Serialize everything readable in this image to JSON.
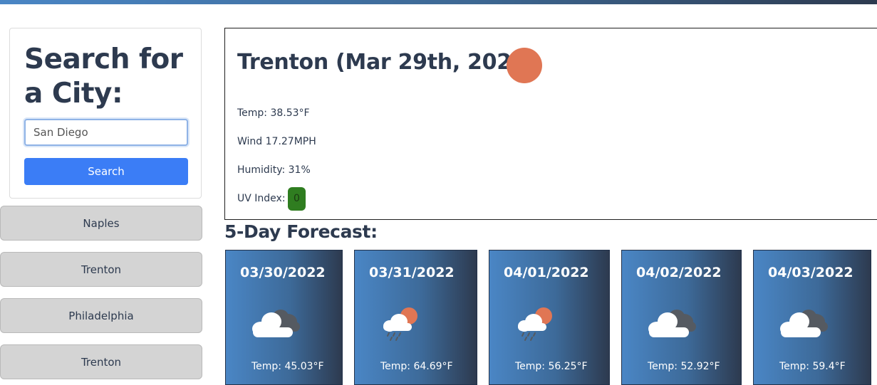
{
  "search": {
    "title": "Search for a City:",
    "input_value": "San Diego",
    "button_label": "Search"
  },
  "history": [
    "Naples",
    "Trenton",
    "Philadelphia",
    "Trenton"
  ],
  "current": {
    "title": "Trenton (Mar 29th, 2022)",
    "icon": "sun-icon",
    "temp": "Temp: 38.53°F",
    "wind": "Wind 17.27MPH",
    "humidity": "Humidity: 31%",
    "uv_label": "UV Index:",
    "uv_value": "0",
    "uv_color": "#2f7d20"
  },
  "forecast_heading": "5-Day Forecast:",
  "forecast": [
    {
      "date": "03/30/2022",
      "icon": "cloudy-icon",
      "temp": "Temp: 45.03°F"
    },
    {
      "date": "03/31/2022",
      "icon": "rain-sun-icon",
      "temp": "Temp: 64.69°F"
    },
    {
      "date": "04/01/2022",
      "icon": "rain-sun-icon",
      "temp": "Temp: 56.25°F"
    },
    {
      "date": "04/02/2022",
      "icon": "cloudy-icon",
      "temp": "Temp: 52.92°F"
    },
    {
      "date": "04/03/2022",
      "icon": "cloudy-icon",
      "temp": "Temp: 59.4°F"
    }
  ],
  "colors": {
    "accent_blue": "#3b7df6",
    "heading": "#2d3a4f",
    "sun": "#e07654"
  }
}
